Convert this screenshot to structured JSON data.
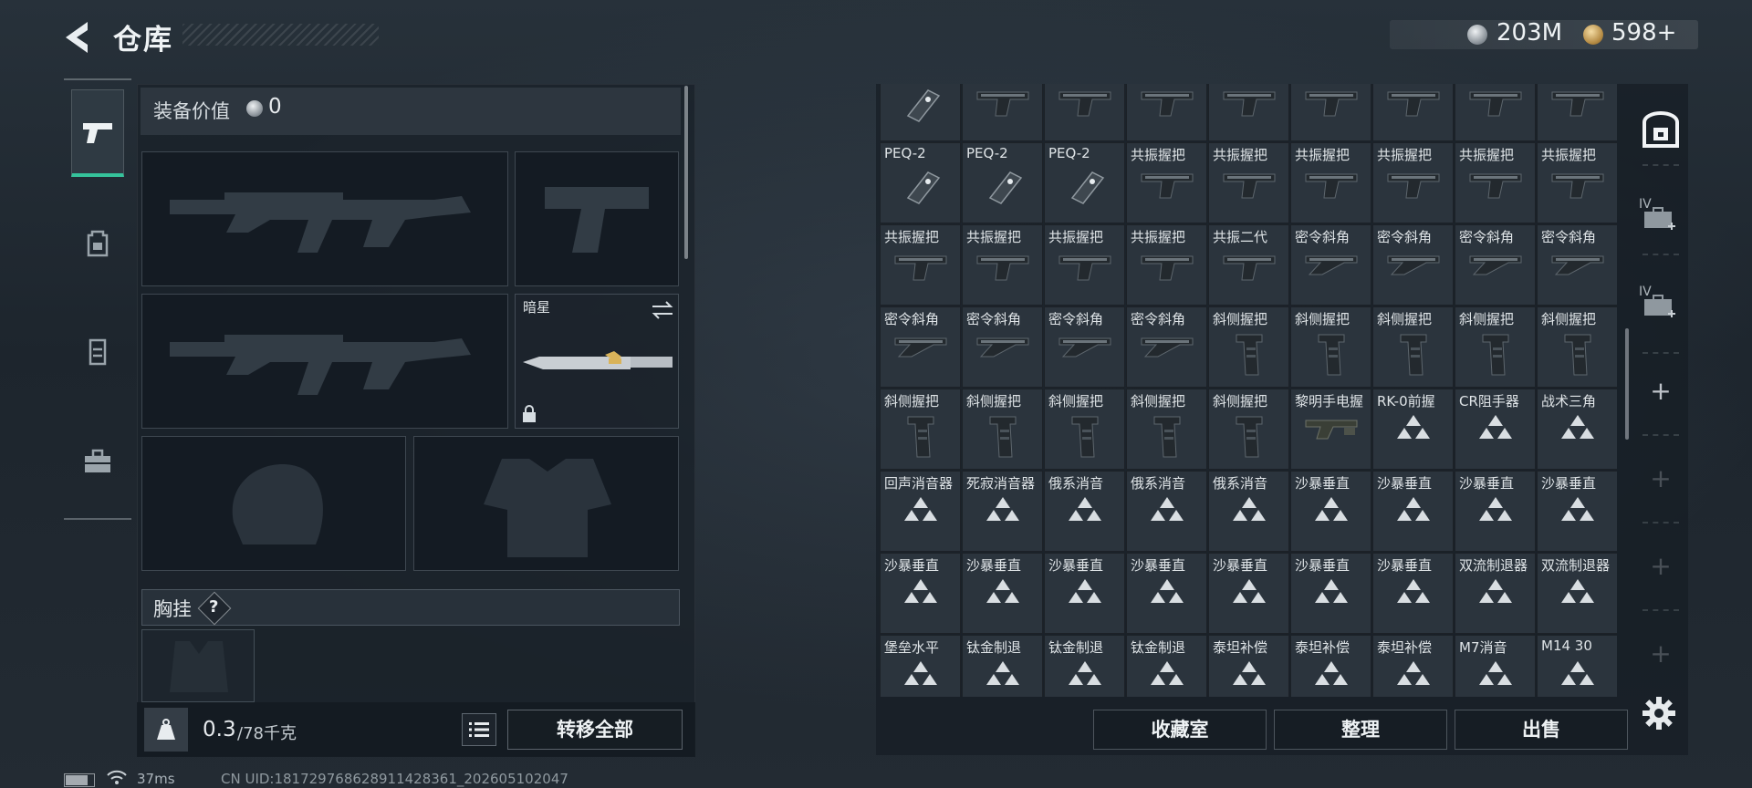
{
  "header": {
    "title": "仓库",
    "currency": {
      "silver_amount": "203M",
      "gold_amount": "598+"
    }
  },
  "left_rail": {
    "tabs": [
      {
        "icon": "pistol-icon",
        "selected": true
      },
      {
        "icon": "backpack-icon",
        "selected": false
      },
      {
        "icon": "vest-icon",
        "selected": false
      },
      {
        "icon": "toolbox-icon",
        "selected": false
      }
    ]
  },
  "loadout": {
    "equip_value_label": "装备价值",
    "equip_value": "0",
    "melee_name": "暗星",
    "chest_rig_label": "胸挂",
    "help_label": "?",
    "weight_current": "0.3",
    "weight_max": "/78千克",
    "transfer_all_label": "转移全部"
  },
  "storage": {
    "items": [
      {
        "name": "",
        "icon": "peq-icon"
      },
      {
        "name": "",
        "icon": "grip-icon"
      },
      {
        "name": "",
        "icon": "grip-icon"
      },
      {
        "name": "",
        "icon": "grip-icon"
      },
      {
        "name": "",
        "icon": "grip-icon"
      },
      {
        "name": "",
        "icon": "grip-icon"
      },
      {
        "name": "",
        "icon": "grip-icon"
      },
      {
        "name": "",
        "icon": "grip-icon"
      },
      {
        "name": "",
        "icon": "grip-icon"
      },
      {
        "name": "PEQ-2",
        "icon": "peq-icon"
      },
      {
        "name": "PEQ-2",
        "icon": "peq-icon"
      },
      {
        "name": "PEQ-2",
        "icon": "peq-icon"
      },
      {
        "name": "共振握把",
        "icon": "grip-icon"
      },
      {
        "name": "共振握把",
        "icon": "grip-icon"
      },
      {
        "name": "共振握把",
        "icon": "grip-icon"
      },
      {
        "name": "共振握把",
        "icon": "grip-icon"
      },
      {
        "name": "共振握把",
        "icon": "grip-icon"
      },
      {
        "name": "共振握把",
        "icon": "grip-icon"
      },
      {
        "name": "共振握把",
        "icon": "grip-icon"
      },
      {
        "name": "共振握把",
        "icon": "grip-icon"
      },
      {
        "name": "共振握把",
        "icon": "grip-icon"
      },
      {
        "name": "共振握把",
        "icon": "grip-icon"
      },
      {
        "name": "共振二代",
        "icon": "grip-icon"
      },
      {
        "name": "密令斜角",
        "icon": "angled-grip-icon"
      },
      {
        "name": "密令斜角",
        "icon": "angled-grip-icon"
      },
      {
        "name": "密令斜角",
        "icon": "angled-grip-icon"
      },
      {
        "name": "密令斜角",
        "icon": "angled-grip-icon"
      },
      {
        "name": "密令斜角",
        "icon": "angled-grip-icon"
      },
      {
        "name": "密令斜角",
        "icon": "angled-grip-icon"
      },
      {
        "name": "密令斜角",
        "icon": "angled-grip-icon"
      },
      {
        "name": "密令斜角",
        "icon": "angled-grip-icon"
      },
      {
        "name": "斜侧握把",
        "icon": "vertical-grip-icon"
      },
      {
        "name": "斜侧握把",
        "icon": "vertical-grip-icon"
      },
      {
        "name": "斜侧握把",
        "icon": "vertical-grip-icon"
      },
      {
        "name": "斜侧握把",
        "icon": "vertical-grip-icon"
      },
      {
        "name": "斜侧握把",
        "icon": "vertical-grip-icon"
      },
      {
        "name": "斜侧握把",
        "icon": "vertical-grip-icon"
      },
      {
        "name": "斜侧握把",
        "icon": "vertical-grip-icon"
      },
      {
        "name": "斜侧握把",
        "icon": "vertical-grip-icon"
      },
      {
        "name": "斜侧握把",
        "icon": "vertical-grip-icon"
      },
      {
        "name": "斜侧握把",
        "icon": "vertical-grip-icon"
      },
      {
        "name": "黎明手电握",
        "icon": "flashlight-grip-icon"
      },
      {
        "name": "RK-0前握",
        "icon": "triangle-placeholder-icon"
      },
      {
        "name": "CR阻手器",
        "icon": "triangle-placeholder-icon"
      },
      {
        "name": "战术三角",
        "icon": "triangle-placeholder-icon"
      },
      {
        "name": "回声消音器",
        "icon": "triangle-placeholder-icon"
      },
      {
        "name": "死寂消音器",
        "icon": "triangle-placeholder-icon"
      },
      {
        "name": "俄系消音",
        "icon": "triangle-placeholder-icon"
      },
      {
        "name": "俄系消音",
        "icon": "triangle-placeholder-icon"
      },
      {
        "name": "俄系消音",
        "icon": "triangle-placeholder-icon"
      },
      {
        "name": "沙暴垂直",
        "icon": "triangle-placeholder-icon"
      },
      {
        "name": "沙暴垂直",
        "icon": "triangle-placeholder-icon"
      },
      {
        "name": "沙暴垂直",
        "icon": "triangle-placeholder-icon"
      },
      {
        "name": "沙暴垂直",
        "icon": "triangle-placeholder-icon"
      },
      {
        "name": "沙暴垂直",
        "icon": "triangle-placeholder-icon"
      },
      {
        "name": "沙暴垂直",
        "icon": "triangle-placeholder-icon"
      },
      {
        "name": "沙暴垂直",
        "icon": "triangle-placeholder-icon"
      },
      {
        "name": "沙暴垂直",
        "icon": "triangle-placeholder-icon"
      },
      {
        "name": "沙暴垂直",
        "icon": "triangle-placeholder-icon"
      },
      {
        "name": "沙暴垂直",
        "icon": "triangle-placeholder-icon"
      },
      {
        "name": "沙暴垂直",
        "icon": "triangle-placeholder-icon"
      },
      {
        "name": "双流制退器",
        "icon": "triangle-placeholder-icon"
      },
      {
        "name": "双流制退器",
        "icon": "triangle-placeholder-icon"
      },
      {
        "name": "堡垒水平",
        "icon": "triangle-placeholder-icon"
      },
      {
        "name": "钛金制退",
        "icon": "triangle-placeholder-icon"
      },
      {
        "name": "钛金制退",
        "icon": "triangle-placeholder-icon"
      },
      {
        "name": "钛金制退",
        "icon": "triangle-placeholder-icon"
      },
      {
        "name": "泰坦补偿",
        "icon": "triangle-placeholder-icon"
      },
      {
        "name": "泰坦补偿",
        "icon": "triangle-placeholder-icon"
      },
      {
        "name": "泰坦补偿",
        "icon": "triangle-placeholder-icon"
      },
      {
        "name": "M7消音",
        "icon": "triangle-placeholder-icon"
      },
      {
        "name": "M14 30",
        "icon": "triangle-placeholder-icon"
      }
    ]
  },
  "right_rail": {
    "badges": [
      "IV",
      "IV"
    ]
  },
  "actions": {
    "vault_label": "收藏室",
    "organize_label": "整理",
    "sell_label": "出售"
  },
  "footer": {
    "ping": "37ms",
    "uid": "CN UID:1817297686289114283​61_202605102047"
  },
  "colors": {
    "accent": "#35c39b",
    "background": "#1b232b",
    "cell": "#2b343d"
  }
}
